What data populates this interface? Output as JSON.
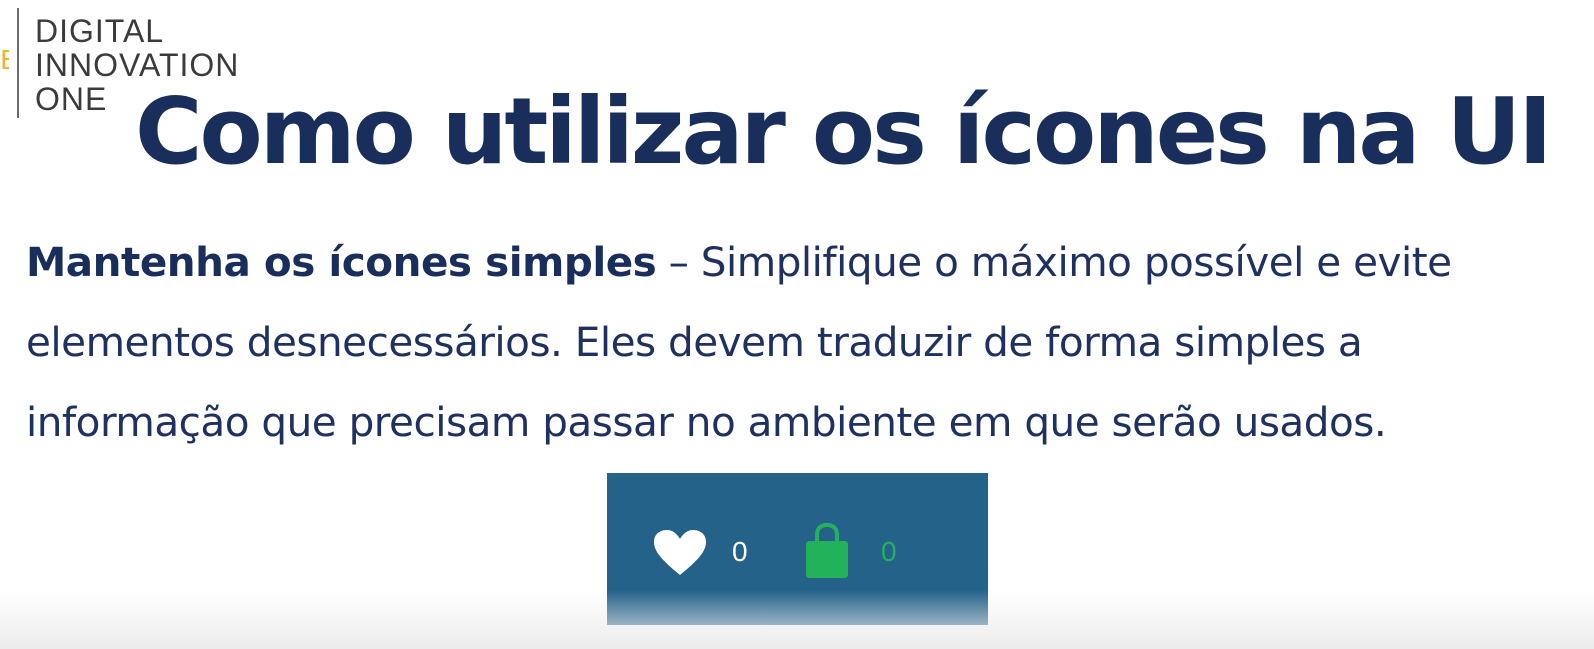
{
  "logo": {
    "lines": [
      "DIGITAL",
      "INNOVATION",
      "ONE"
    ]
  },
  "slide": {
    "title": "Como utilizar os ícones na UI",
    "lead": "Mantenha os ícones simples",
    "line1_rest": " – Simplifique o máximo possível e evite",
    "line2": "elementos desnecessários. Eles devem traduzir de forma simples a",
    "line3": "informação que precisam passar no ambiente em que serão usados."
  },
  "icon_bar": {
    "icons": [
      "heart-icon",
      "shopping-bag-icon"
    ],
    "like_count": "0",
    "cart_count": "0"
  },
  "colors": {
    "title": "#1a2e5c",
    "text": "#1f3160",
    "bar_background": "#24628a",
    "heart": "#ffffff",
    "bag": "#22b35a",
    "logo_accent": "#f0b429"
  }
}
